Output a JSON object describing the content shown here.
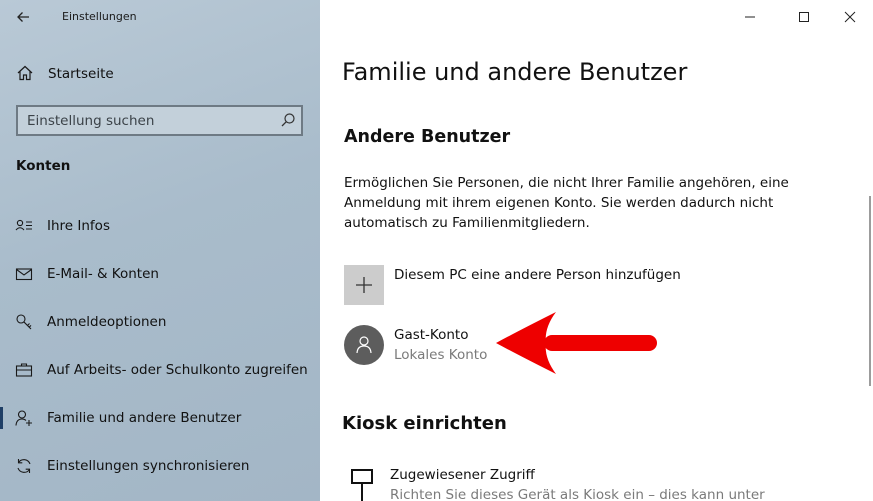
{
  "app": {
    "title": "Einstellungen"
  },
  "sidebar": {
    "home_label": "Startseite",
    "search_placeholder": "Einstellung suchen",
    "section_title": "Konten",
    "items": [
      {
        "label": "Ihre Infos",
        "icon": "person-card-icon"
      },
      {
        "label": "E-Mail- & Konten",
        "icon": "mail-icon"
      },
      {
        "label": "Anmeldeoptionen",
        "icon": "key-icon"
      },
      {
        "label": "Auf Arbeits- oder Schulkonto zugreifen",
        "icon": "briefcase-icon"
      },
      {
        "label": "Familie und andere Benutzer",
        "icon": "add-person-icon",
        "selected": true
      },
      {
        "label": "Einstellungen synchronisieren",
        "icon": "sync-icon"
      }
    ]
  },
  "main": {
    "page_title": "Familie und andere Benutzer",
    "section_title": "Andere Benutzer",
    "description": "Ermöglichen Sie Personen, die nicht Ihrer Familie angehören, eine Anmeldung mit ihrem eigenen Konto. Sie werden dadurch nicht automatisch zu Familienmitgliedern.",
    "add_person_label": "Diesem PC eine andere Person hinzufügen",
    "guest": {
      "name": "Gast-Konto",
      "type": "Lokales Konto"
    },
    "kiosk": {
      "title": "Kiosk einrichten",
      "item_name": "Zugewiesener Zugriff",
      "item_desc": "Richten Sie dieses Gerät als Kiosk ein – dies kann unter"
    }
  },
  "colors": {
    "annotation_arrow": "#ee0000",
    "sidebar_bg": "#a9bccb",
    "avatar_bg": "#5d5d5d",
    "selection_indicator": "#1f3f66"
  }
}
